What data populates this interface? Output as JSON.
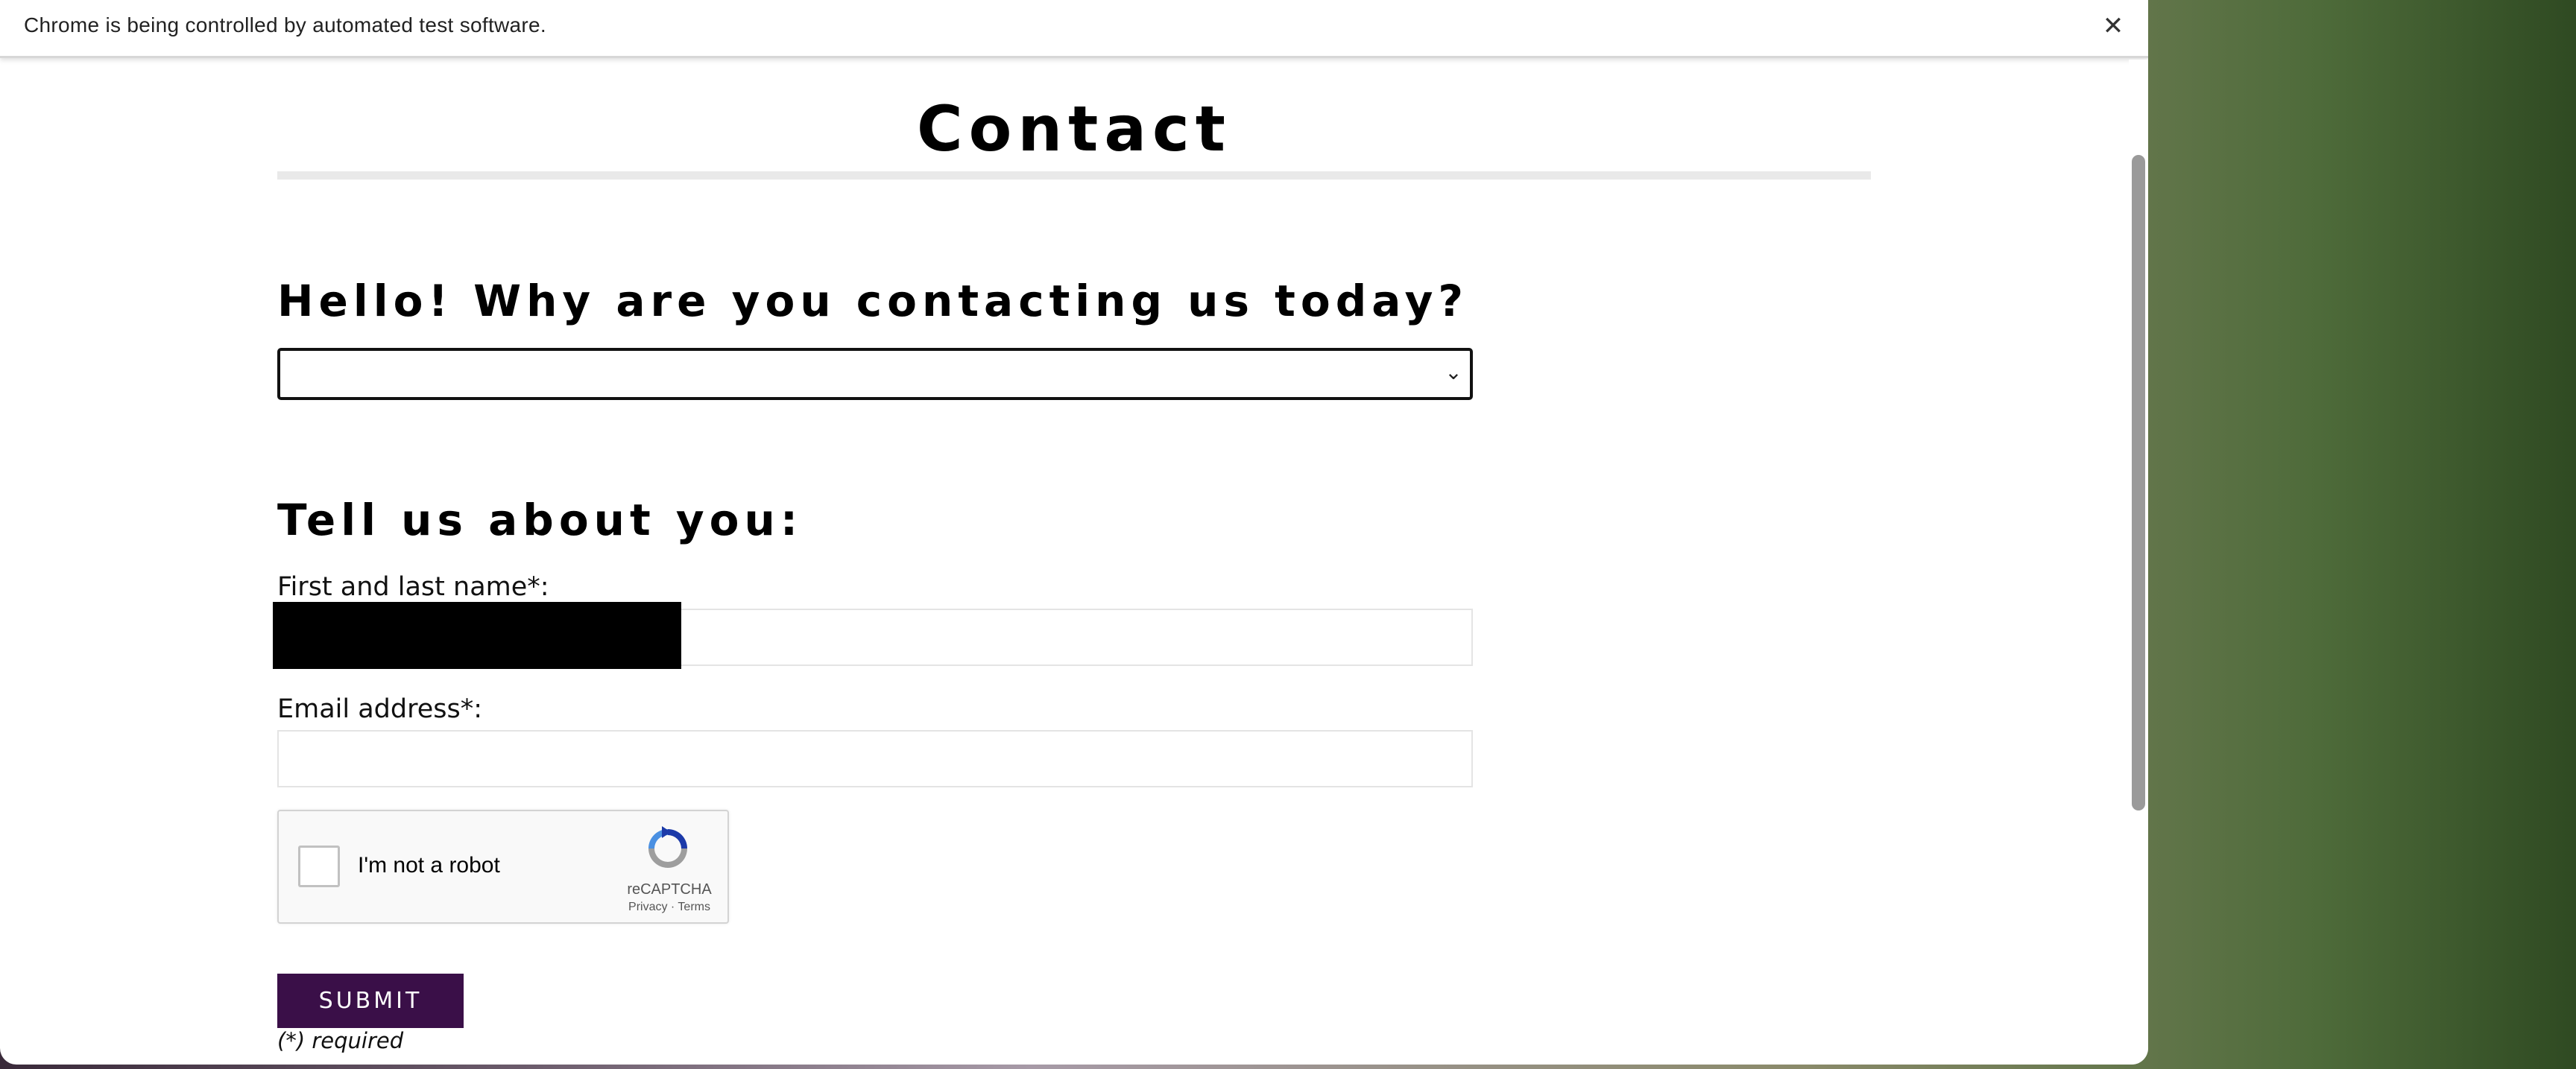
{
  "infobar": {
    "message": "Chrome is being controlled by automated test software.",
    "close_icon": "close-icon"
  },
  "page": {
    "title": "Contact",
    "section_reason": "Hello! Why are you contacting us today?",
    "reason_select": {
      "selected": "",
      "icon": "chevron-down-icon"
    },
    "section_about": "Tell us about you:",
    "name_label": "First and last name*:",
    "name_value": "",
    "email_label": "Email address*:",
    "email_value": ""
  },
  "recaptcha": {
    "label": "I'm not a robot",
    "brand": "reCAPTCHA",
    "links": "Privacy - Terms",
    "icon": "recaptcha-logo-icon",
    "checked": false
  },
  "form": {
    "submit_label": "SUBMIT",
    "required_note": "(*) required",
    "submit_color": "#3a0f48"
  }
}
